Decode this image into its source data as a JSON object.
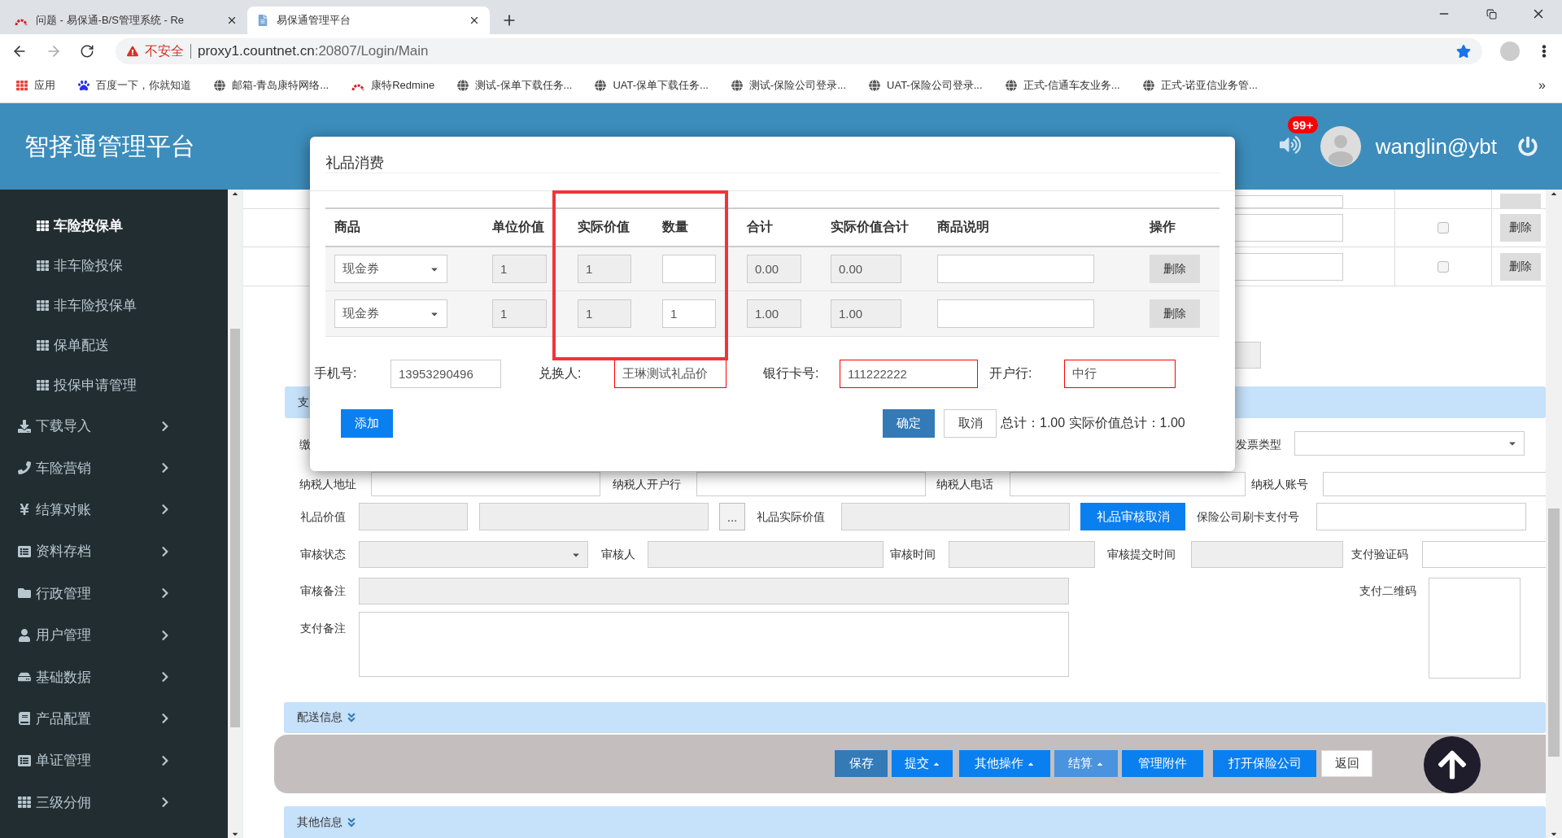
{
  "browser": {
    "tabs": [
      {
        "title": "问题 - 易保通-B/S管理系统 - Re",
        "selected": false
      },
      {
        "title": "易保通管理平台",
        "selected": true
      }
    ],
    "address": {
      "warning": "不安全",
      "host": "proxy1.countnet.cn",
      "path": ":20807/Login/Main"
    },
    "bookmarks": [
      "应用",
      "百度一下，你就知道",
      "邮箱-青岛康特网络...",
      "康特Redmine",
      "测试-保单下载任务...",
      "UAT-保单下载任务...",
      "测试-保险公司登录...",
      "UAT-保险公司登录...",
      "正式-信通车友业务...",
      "正式-诺亚信业务管..."
    ],
    "bookmarks_more": "»"
  },
  "header": {
    "title": "智择通管理平台",
    "badge": "99+",
    "user": "wanglin@ybt"
  },
  "sidebar": {
    "items": [
      {
        "label": "车险投保单",
        "kind": "sub",
        "selected": true
      },
      {
        "label": "非车险投保",
        "kind": "sub",
        "selected": false
      },
      {
        "label": "非车险投保单",
        "kind": "sub",
        "selected": false
      },
      {
        "label": "保单配送",
        "kind": "sub",
        "selected": false
      },
      {
        "label": "投保申请管理",
        "kind": "sub",
        "selected": false
      },
      {
        "label": "下载导入",
        "kind": "group",
        "selected": false
      },
      {
        "label": "车险营销",
        "kind": "group",
        "selected": false
      },
      {
        "label": "结算对账",
        "kind": "group",
        "selected": false
      },
      {
        "label": "资料存档",
        "kind": "group",
        "selected": false
      },
      {
        "label": "行政管理",
        "kind": "group",
        "selected": false
      },
      {
        "label": "用户管理",
        "kind": "group",
        "selected": false
      },
      {
        "label": "基础数据",
        "kind": "group",
        "selected": false
      },
      {
        "label": "产品配置",
        "kind": "group",
        "selected": false
      },
      {
        "label": "单证管理",
        "kind": "group",
        "selected": false
      },
      {
        "label": "三级分佣",
        "kind": "group",
        "selected": false
      }
    ]
  },
  "page": {
    "table_rows": [
      {
        "checked": false,
        "action": "删除"
      },
      {
        "checked": false,
        "action": "删除"
      }
    ],
    "section_title": "支",
    "payment_label": "缴",
    "invoice_type_label": "发票类型",
    "form_rows": [
      [
        {
          "kind": "label",
          "text": "纳税人地址"
        },
        {
          "kind": "input",
          "disabled": false
        },
        {
          "kind": "label",
          "text": "纳税人开户行"
        },
        {
          "kind": "input",
          "disabled": false
        },
        {
          "kind": "label",
          "text": "纳税人电话"
        },
        {
          "kind": "input",
          "disabled": false
        },
        {
          "kind": "label",
          "text": "纳税人账号"
        },
        {
          "kind": "input",
          "disabled": false
        }
      ],
      [
        {
          "kind": "label",
          "text": "礼品价值"
        },
        {
          "kind": "input",
          "disabled": true
        },
        {
          "kind": "input",
          "disabled": true
        },
        {
          "kind": "button",
          "text": "...",
          "primary": false
        },
        {
          "kind": "label",
          "text": "礼品实际价值"
        },
        {
          "kind": "input",
          "disabled": true
        },
        {
          "kind": "button",
          "text": "礼品审核取消",
          "primary": true
        },
        {
          "kind": "label",
          "text": "保险公司刷卡支付号"
        },
        {
          "kind": "input",
          "disabled": false
        }
      ],
      [
        {
          "kind": "label",
          "text": "审核状态"
        },
        {
          "kind": "select",
          "disabled": true
        },
        {
          "kind": "label",
          "text": "审核人"
        },
        {
          "kind": "input",
          "disabled": true
        },
        {
          "kind": "label",
          "text": "审核时间"
        },
        {
          "kind": "input",
          "disabled": true
        },
        {
          "kind": "label",
          "text": "审核提交时间"
        },
        {
          "kind": "input",
          "disabled": true
        },
        {
          "kind": "label",
          "text": "支付验证码"
        },
        {
          "kind": "input",
          "disabled": false
        }
      ],
      [
        {
          "kind": "label",
          "text": "审核备注"
        },
        {
          "kind": "input",
          "disabled": true
        },
        {
          "kind": "label",
          "text": "支付二维码"
        },
        {
          "kind": "qr_box"
        }
      ],
      [
        {
          "kind": "label",
          "text": "支付备注"
        },
        {
          "kind": "textarea",
          "disabled": false
        }
      ]
    ],
    "delivery_section": "配送信息",
    "actions": [
      {
        "label": "保存",
        "kind": "dark"
      },
      {
        "label": "提交",
        "kind": "menu"
      },
      {
        "label": "其他操作",
        "kind": "menu"
      },
      {
        "label": "结算",
        "kind": "menu_light"
      },
      {
        "label": "管理附件",
        "kind": "primary"
      },
      {
        "label": "打开保险公司",
        "kind": "primary"
      },
      {
        "label": "返回",
        "kind": "plain"
      }
    ],
    "other_section": "其他信息"
  },
  "dialog": {
    "title": "礼品消费",
    "columns": [
      "商品",
      "单位价值",
      "实际价值",
      "数量",
      "合计",
      "实际价值合计",
      "商品说明",
      "操作"
    ],
    "rows": [
      {
        "product": "现金券",
        "unit_value": "1",
        "actual_value": "1",
        "total": "0.00",
        "actual_total": "0.00",
        "action": "删除"
      },
      {
        "product": "现金券",
        "unit_value": "1",
        "actual_value": "1",
        "quantity": "1",
        "total": "1.00",
        "actual_total": "1.00",
        "action": "删除"
      }
    ],
    "fields": [
      {
        "label": "手机号:",
        "value": "13953290496",
        "invalid": false
      },
      {
        "label": "兑换人:",
        "value": "王琳测试礼品价",
        "invalid": true
      },
      {
        "label": "银行卡号:",
        "value": "111222222",
        "invalid": true
      },
      {
        "label": "开户行:",
        "value": "中行",
        "invalid": true
      }
    ],
    "add": "添加",
    "confirm": "确定",
    "cancel": "取消",
    "summary": "总计：1.00 实际价值总计：1.00"
  }
}
